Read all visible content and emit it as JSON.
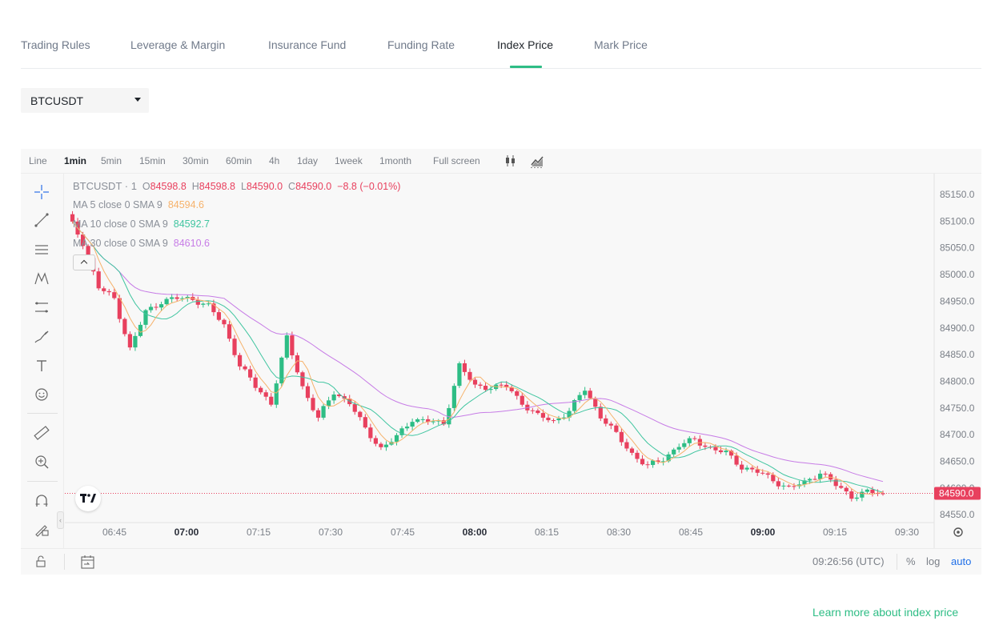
{
  "tabs": [
    {
      "label": "Trading Rules",
      "active": false
    },
    {
      "label": "Leverage & Margin",
      "active": false
    },
    {
      "label": "Insurance Fund",
      "active": false
    },
    {
      "label": "Funding Rate",
      "active": false
    },
    {
      "label": "Index Price",
      "active": true
    },
    {
      "label": "Mark Price",
      "active": false
    }
  ],
  "symbol_select": {
    "value": "BTCUSDT"
  },
  "toolbar": {
    "timeframes": [
      {
        "label": "Line",
        "active": false
      },
      {
        "label": "1min",
        "active": true
      },
      {
        "label": "5min",
        "active": false
      },
      {
        "label": "15min",
        "active": false
      },
      {
        "label": "30min",
        "active": false
      },
      {
        "label": "60min",
        "active": false
      },
      {
        "label": "4h",
        "active": false
      },
      {
        "label": "1day",
        "active": false
      },
      {
        "label": "1week",
        "active": false
      },
      {
        "label": "1month",
        "active": false
      }
    ],
    "fullscreen_label": "Full screen",
    "icons": [
      "candle-type-icon",
      "indicators-icon"
    ]
  },
  "left_tools": [
    "crosshair-icon",
    "trend-line-icon",
    "horizontal-lines-icon",
    "pattern-icon",
    "measure-lines-icon",
    "brush-icon",
    "text-icon",
    "emoji-icon",
    "ruler-icon",
    "zoom-in-icon",
    "magnet-icon",
    "lock-drawing-icon",
    "unlock-icon"
  ],
  "legend": {
    "symbol": "BTCUSDT · 1",
    "o_label": "O",
    "o_value": "84598.8",
    "h_label": "H",
    "h_value": "84598.8",
    "l_label": "L",
    "l_value": "84590.0",
    "c_label": "C",
    "c_value": "84590.0",
    "change": "−8.8 (−0.01%)",
    "ma5_label": "MA 5 close 0 SMA 9",
    "ma5_value": "84594.6",
    "ma10_label": "MA 10 close 0 SMA 9",
    "ma10_value": "84592.7",
    "ma30_label": "MA 30 close 0 SMA 9",
    "ma30_value": "84610.6"
  },
  "colors": {
    "up": "#2ebd85",
    "down": "#e8405e",
    "ma5": "#f6b26b",
    "ma10": "#40c5a0",
    "ma30": "#c77ce6",
    "accent": "#2ebd85",
    "link": "#1e6ee8"
  },
  "chart_data": {
    "type": "candlestick",
    "y_ticks": [
      "85150.0",
      "85100.0",
      "85050.0",
      "85000.0",
      "84950.0",
      "84900.0",
      "84850.0",
      "84800.0",
      "84750.0",
      "84700.0",
      "84650.0",
      "84600.0",
      "84550.0"
    ],
    "ylim": [
      84540,
      85165
    ],
    "x_ticks": [
      "06:45",
      "07:00",
      "07:15",
      "07:30",
      "07:45",
      "08:00",
      "08:15",
      "08:30",
      "08:45",
      "09:00",
      "09:15",
      "09:30"
    ],
    "bold_x_ticks": [
      "07:00",
      "08:00",
      "09:00"
    ],
    "current_price": "84590.0",
    "close_path": [
      [
        0,
        85110
      ],
      [
        3,
        85060
      ],
      [
        6,
        84975
      ],
      [
        9,
        84955
      ],
      [
        12,
        84860
      ],
      [
        15,
        84930
      ],
      [
        18,
        84950
      ],
      [
        21,
        84955
      ],
      [
        24,
        84955
      ],
      [
        27,
        84940
      ],
      [
        30,
        84905
      ],
      [
        33,
        84830
      ],
      [
        36,
        84790
      ],
      [
        39,
        84760
      ],
      [
        42,
        84880
      ],
      [
        45,
        84790
      ],
      [
        48,
        84730
      ],
      [
        51,
        84780
      ],
      [
        54,
        84760
      ],
      [
        57,
        84710
      ],
      [
        60,
        84675
      ],
      [
        63,
        84695
      ],
      [
        66,
        84730
      ],
      [
        69,
        84725
      ],
      [
        72,
        84720
      ],
      [
        75,
        84830
      ],
      [
        78,
        84790
      ],
      [
        81,
        84790
      ],
      [
        84,
        84790
      ],
      [
        87,
        84760
      ],
      [
        90,
        84735
      ],
      [
        93,
        84725
      ],
      [
        96,
        84745
      ],
      [
        99,
        84785
      ],
      [
        102,
        84735
      ],
      [
        105,
        84700
      ],
      [
        108,
        84665
      ],
      [
        111,
        84640
      ],
      [
        114,
        84655
      ],
      [
        117,
        84680
      ],
      [
        120,
        84690
      ],
      [
        123,
        84675
      ],
      [
        126,
        84665
      ],
      [
        129,
        84640
      ],
      [
        132,
        84630
      ],
      [
        135,
        84615
      ],
      [
        138,
        84600
      ],
      [
        141,
        84610
      ],
      [
        144,
        84630
      ],
      [
        147,
        84605
      ],
      [
        150,
        84585
      ],
      [
        153,
        84592
      ],
      [
        156,
        84590
      ]
    ]
  },
  "bottom_bar": {
    "time": "09:26:56 (UTC)",
    "percent": "%",
    "log": "log",
    "auto": "auto"
  },
  "learn_more": "Learn more about index price"
}
